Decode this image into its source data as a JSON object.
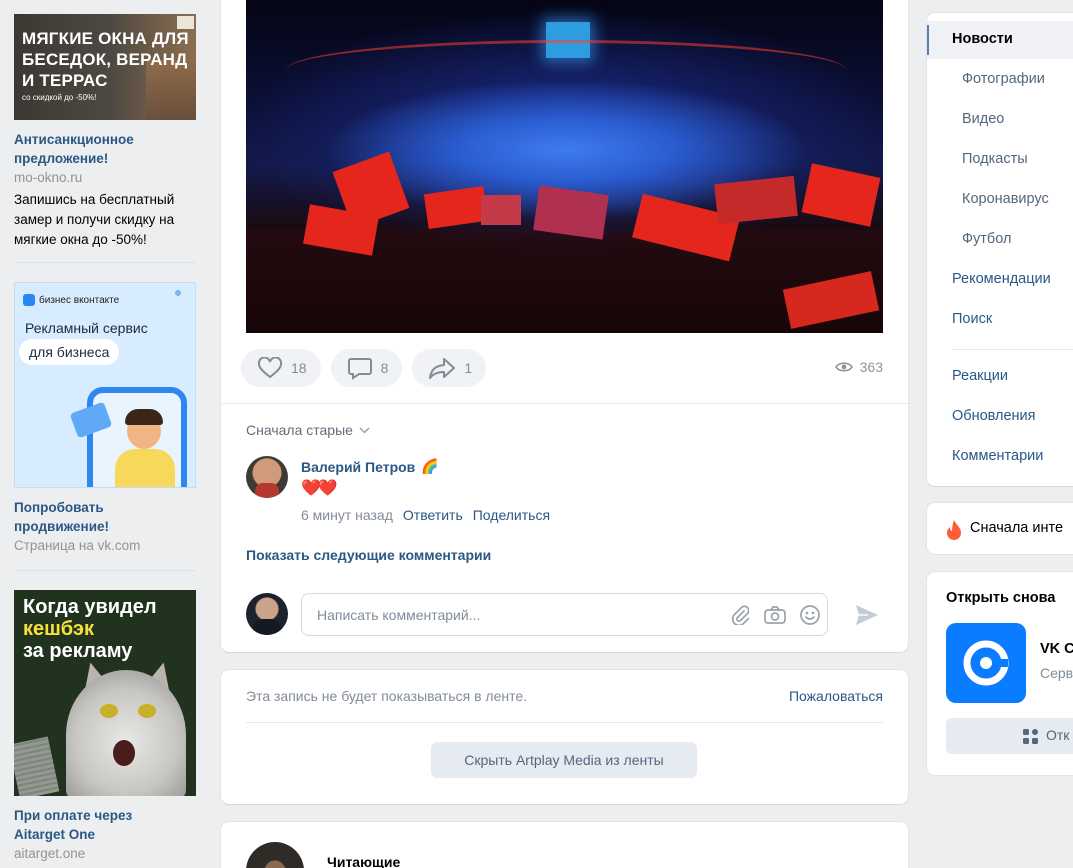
{
  "ads": [
    {
      "image_text_main": "МЯГКИЕ ОКНА ДЛЯ БЕСЕДОК, ВЕРАНД И ТЕРРАС",
      "image_text_small": "со скидкой до -50%!",
      "title": "Антисанкционное предложение!",
      "domain": "mo-okno.ru",
      "text": "Запишись на бесплатный замер и получи скидку на мягкие окна до -50%!"
    },
    {
      "image_brand": "бизнес вконтакте",
      "image_line1": "Рекламный сервис",
      "image_line2": "для бизнеса",
      "title": "Попробовать продвижение!",
      "domain": "Страница на vk.com"
    },
    {
      "image_line1": "Когда увидел",
      "image_line2": "кешбэк",
      "image_line3": "за рекламу",
      "title": "При оплате через Aitarget One",
      "domain": "aitarget.one"
    }
  ],
  "post": {
    "likes": "18",
    "comments": "8",
    "shares": "1",
    "views": "363",
    "sort_label": "Сначала старые",
    "comment": {
      "author": "Валерий Петров",
      "author_badge": "🌈",
      "text": "❤️❤️",
      "time": "6 минут назад",
      "reply": "Ответить",
      "share": "Поделиться"
    },
    "show_more": "Показать следующие комментарии",
    "composer_placeholder": "Написать комментарий..."
  },
  "hide_card": {
    "note": "Эта запись не будет показываться в ленте.",
    "report": "Пожаловаться",
    "hide_button": "Скрыть Artplay Media из ленты"
  },
  "next_card": {
    "title": "Читающие"
  },
  "right_nav": {
    "items": [
      {
        "label": "Новости",
        "active": true
      },
      {
        "label": "Фотографии",
        "sub": true
      },
      {
        "label": "Видео",
        "sub": true
      },
      {
        "label": "Подкасты",
        "sub": true
      },
      {
        "label": "Коронавирус",
        "sub": true
      },
      {
        "label": "Футбол",
        "sub": true
      },
      {
        "label": "Рекомендации"
      },
      {
        "label": "Поиск"
      },
      {
        "label": "Реакции"
      },
      {
        "label": "Обновления"
      },
      {
        "label": "Комментарии"
      }
    ]
  },
  "right_sort": {
    "label": "Сначала инте"
  },
  "reopen": {
    "header": "Открыть снова",
    "app_name": "VK C",
    "app_sub": "Серв",
    "button": "Отк"
  },
  "colors": {
    "link": "#2a5885",
    "muted": "#818c99",
    "accent": "#0a7cff",
    "background": "#edeef0"
  }
}
